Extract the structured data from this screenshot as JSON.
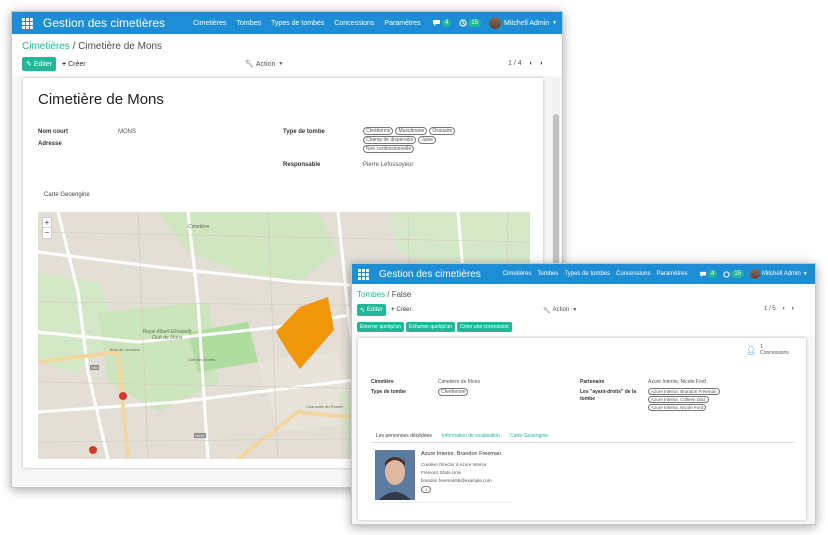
{
  "colors": {
    "nav": "#1d8dd6",
    "accent": "#21b799",
    "polygon": "#f0960a"
  },
  "window1": {
    "app_title": "Gestion des cimetières",
    "menu": [
      "Cimetières",
      "Tombes",
      "Types de tombes",
      "Concessions",
      "Paramètres"
    ],
    "chat_count": "4",
    "activity_count": "15",
    "user": "Mitchell Admin",
    "breadcrumb": {
      "parent": "Cimetières",
      "current": "Cimetière de Mons"
    },
    "edit_label": "Editer",
    "create_label": "Créer",
    "action_label": "Action",
    "pager": "1 / 4",
    "record_title": "Cimetière de Mons",
    "fields": {
      "short_name_label": "Nom court",
      "short_name_value": "MONS",
      "address_label": "Adresse",
      "grave_type_label": "Type de tombe",
      "grave_types": [
        "Chrétienne",
        "Musulmane",
        "Ossuaire",
        "Champ de dispersion",
        "Juive",
        "Non confessionnelle"
      ],
      "manager_label": "Responsable",
      "manager_value": "Pierre Lefossoyeur"
    },
    "map_tab": "Carte Geoengine",
    "map": {
      "zoom_in": "+",
      "zoom_out": "−",
      "labels": [
        "Cimetière",
        "Royal Albert Elisabeth Club de Mons",
        "Bois de Lescarts",
        "Cité des Arbres",
        "N50",
        "N538",
        "Chaussée du Roeulx"
      ]
    }
  },
  "window2": {
    "app_title": "Gestion des cimetières",
    "menu": [
      "Cimetières",
      "Tombes",
      "Types de tombes",
      "Concessions",
      "Paramètres"
    ],
    "chat_count": "4",
    "activity_count": "15",
    "user": "Mitchell Admin",
    "breadcrumb": {
      "parent": "Tombes",
      "current": "False"
    },
    "edit_label": "Editer",
    "create_label": "Créer",
    "action_label": "Action",
    "pager": "1 / 5",
    "buttons": [
      "Enterrer quelqu'un",
      "Exhumer quelqu'un",
      "Créer une concession"
    ],
    "stat": {
      "count": "1",
      "label": "Concessions"
    },
    "fields": {
      "cemetery_label": "Cimetière",
      "cemetery_value": "Cimetière de Mons",
      "grave_type_label": "Type de tombe",
      "grave_type_tag": "Chrétienne",
      "partner_label": "Partenaire",
      "partner_value": "Azure Interior, Nicole Ford",
      "rights_label": "Les \"ayant-droits\" de la tombe",
      "rights_tags": [
        "Azure Interior, Brandon Freeman",
        "Azure Interior, Colleen Diaz",
        "Azure Interior, Nicole Ford"
      ]
    },
    "tabs": [
      "Les personnes décédées",
      "Information de localisation",
      "Carte Geoengine"
    ],
    "person": {
      "name": "Azure Interior, Brandon Freeman",
      "title": "Creative Director à Azure Interior",
      "city": "Fremont, États-Unis",
      "email": "brandon.freeman55@example.com",
      "tag": "1"
    }
  }
}
